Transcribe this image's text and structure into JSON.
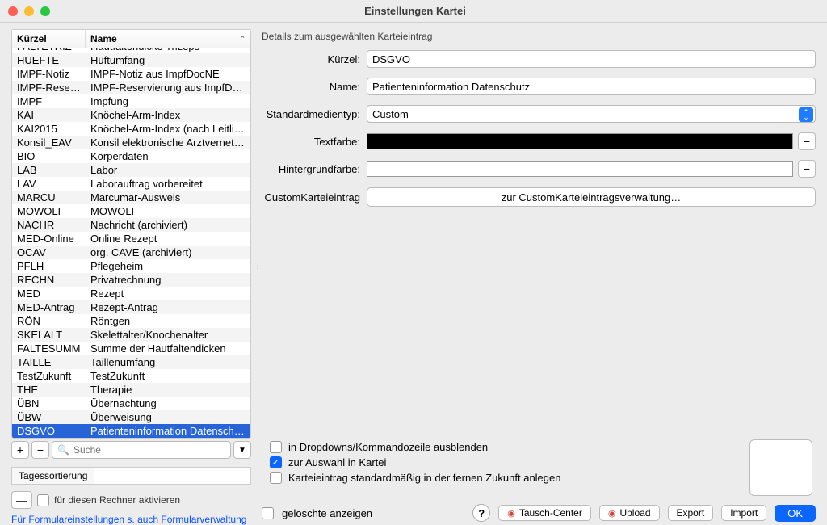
{
  "window": {
    "title": "Einstellungen Kartei"
  },
  "table": {
    "col_kurzel": "Kürzel",
    "col_name": "Name",
    "rows": [
      {
        "k": "FALTETRIZ",
        "n": "Hautfaltendicke Trizeps"
      },
      {
        "k": "HUEFTE",
        "n": "Hüftumfang"
      },
      {
        "k": "IMPF-Notiz",
        "n": "IMPF-Notiz aus ImpfDocNE"
      },
      {
        "k": "IMPF-Reservi...",
        "n": "IMPF-Reservierung aus ImpfDocNE"
      },
      {
        "k": "IMPF",
        "n": "Impfung"
      },
      {
        "k": "KAI",
        "n": "Knöchel-Arm-Index"
      },
      {
        "k": "KAI2015",
        "n": "Knöchel-Arm-Index (nach Leitlini..."
      },
      {
        "k": "Konsil_EAV",
        "n": "Konsil elektronische Arztvernetzu..."
      },
      {
        "k": "BIO",
        "n": "Körperdaten"
      },
      {
        "k": "LAB",
        "n": "Labor"
      },
      {
        "k": "LAV",
        "n": "Laborauftrag vorbereitet"
      },
      {
        "k": "MARCU",
        "n": "Marcumar-Ausweis"
      },
      {
        "k": "MOWOLI",
        "n": "MOWOLI"
      },
      {
        "k": "NACHR",
        "n": "Nachricht (archiviert)"
      },
      {
        "k": "MED-Online",
        "n": "Online Rezept"
      },
      {
        "k": "OCAV",
        "n": "org. CAVE (archiviert)"
      },
      {
        "k": "PFLH",
        "n": "Pflegeheim"
      },
      {
        "k": "RECHN",
        "n": "Privatrechnung"
      },
      {
        "k": "MED",
        "n": "Rezept"
      },
      {
        "k": "MED-Antrag",
        "n": "Rezept-Antrag"
      },
      {
        "k": "RÖN",
        "n": "Röntgen"
      },
      {
        "k": "SKELALT",
        "n": "Skelettalter/Knochenalter"
      },
      {
        "k": "FALTESUMM",
        "n": "Summe der Hautfaltendicken"
      },
      {
        "k": "TAILLE",
        "n": "Taillenumfang"
      },
      {
        "k": "TestZukunft",
        "n": "TestZukunft"
      },
      {
        "k": "THE",
        "n": "Therapie"
      },
      {
        "k": "ÜBN",
        "n": "Übernachtung"
      },
      {
        "k": "ÜBW",
        "n": "Überweisung"
      },
      {
        "k": "DSGVO",
        "n": "Patienteninformation Datenschutz",
        "selected": true
      }
    ]
  },
  "search": {
    "placeholder": "Suche"
  },
  "add_label": "+",
  "remove_label": "−",
  "filter_label": "▼",
  "tagessort": {
    "label": "Tagessortierung"
  },
  "activate": {
    "label": "für diesen Rechner aktivieren",
    "dash": "—"
  },
  "link": "Für Formulareinstellungen s. auch Formularverwaltung",
  "details": {
    "header": "Details zum ausgewählten Karteieintrag",
    "kurzel_label": "Kürzel:",
    "kurzel_value": "DSGVO",
    "name_label": "Name:",
    "name_value": "Patienteninformation Datenschutz",
    "medientyp_label": "Standardmedientyp:",
    "medientyp_value": "Custom",
    "textfarbe_label": "Textfarbe:",
    "hgfarbe_label": "Hintergrundfarbe:",
    "custom_label": "CustomKarteieintrag",
    "custom_button": "zur CustomKarteieintragsverwaltung…",
    "chk_dropdown": "in Dropdowns/Kommandozeile ausblenden",
    "chk_auswahl": "zur Auswahl in Kartei",
    "chk_zukunft": "Karteieintrag standardmäßig in der fernen Zukunft anlegen"
  },
  "footer": {
    "deleted": "gelöschte anzeigen",
    "tausch": "Tausch-Center",
    "upload": "Upload",
    "export": "Export",
    "import": "Import",
    "ok": "OK"
  }
}
